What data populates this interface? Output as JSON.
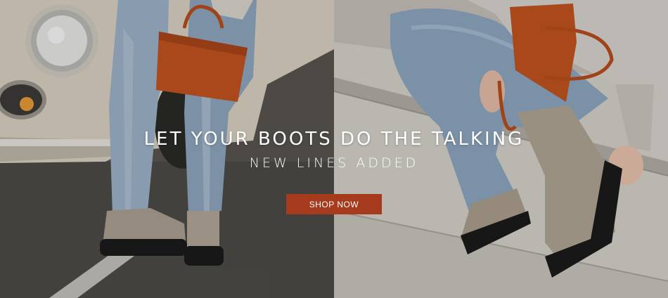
{
  "hero": {
    "headline": "LET YOUR BOOTS DO THE TALKING",
    "subheadline": "NEW LINES ADDED",
    "cta_label": "SHOP NOW"
  },
  "images": {
    "left": "photo-street-boots-orange-bag",
    "right": "photo-steps-boots-orange-bag"
  },
  "colors": {
    "cta": "#a63a1c",
    "text": "#ffffff",
    "bag": "#c1531f",
    "boot": "#a89c8c",
    "denim": "#8fa5bd"
  }
}
